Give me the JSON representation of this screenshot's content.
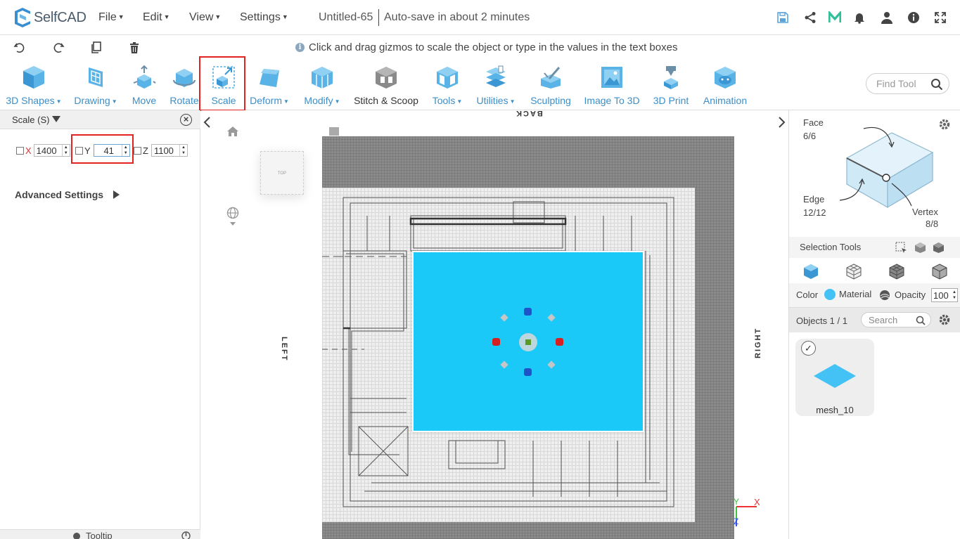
{
  "app": {
    "name": "SelfCAD",
    "doc_title": "Untitled-65",
    "autosave": "Auto-save in about 2 minutes"
  },
  "menu": [
    {
      "label": "File"
    },
    {
      "label": "Edit"
    },
    {
      "label": "View"
    },
    {
      "label": "Settings"
    }
  ],
  "hint": "Click and drag gizmos to scale the object or type in the values in the text boxes",
  "toolbar": {
    "tools": [
      {
        "label": "3D Shapes",
        "dropdown": true
      },
      {
        "label": "Drawing",
        "dropdown": true
      },
      {
        "label": "Move",
        "dropdown": false
      },
      {
        "label": "Rotate",
        "dropdown": false
      },
      {
        "label": "Scale",
        "dropdown": false
      },
      {
        "label": "Deform",
        "dropdown": true
      },
      {
        "label": "Modify",
        "dropdown": true
      },
      {
        "label": "Stitch & Scoop",
        "dropdown": false
      },
      {
        "label": "Tools",
        "dropdown": true
      },
      {
        "label": "Utilities",
        "dropdown": true
      },
      {
        "label": "Sculpting",
        "dropdown": false
      },
      {
        "label": "Image To 3D",
        "dropdown": false
      },
      {
        "label": "3D Print",
        "dropdown": false
      },
      {
        "label": "Animation",
        "dropdown": false
      }
    ],
    "find_placeholder": "Find Tool"
  },
  "scale_panel": {
    "title": "Scale (S)",
    "x_label": "X",
    "x_value": "1400",
    "y_label": "Y",
    "y_value": "41",
    "z_label": "Z",
    "z_value": "1100",
    "advanced": "Advanced Settings",
    "tooltip": "Tooltip"
  },
  "viewport": {
    "cube_label": "TOP",
    "label_back": "BACK",
    "label_left": "LEFT",
    "label_right": "RIGHT",
    "axis_x": "X",
    "axis_y": "Y",
    "axis_z": "Z",
    "mesh_color": "#1ac9f7"
  },
  "right_panel": {
    "face_label": "Face",
    "face_count": "6/6",
    "edge_label": "Edge",
    "edge_count": "12/12",
    "vertex_label": "Vertex",
    "vertex_count": "8/8",
    "selection_tools": "Selection Tools",
    "color_label": "Color",
    "material_label": "Material",
    "opacity_label": "Opacity",
    "opacity_value": "100",
    "objects_label": "Objects 1 / 1",
    "search_placeholder": "Search",
    "object_name": "mesh_10",
    "object_color": "#45c2f5"
  }
}
